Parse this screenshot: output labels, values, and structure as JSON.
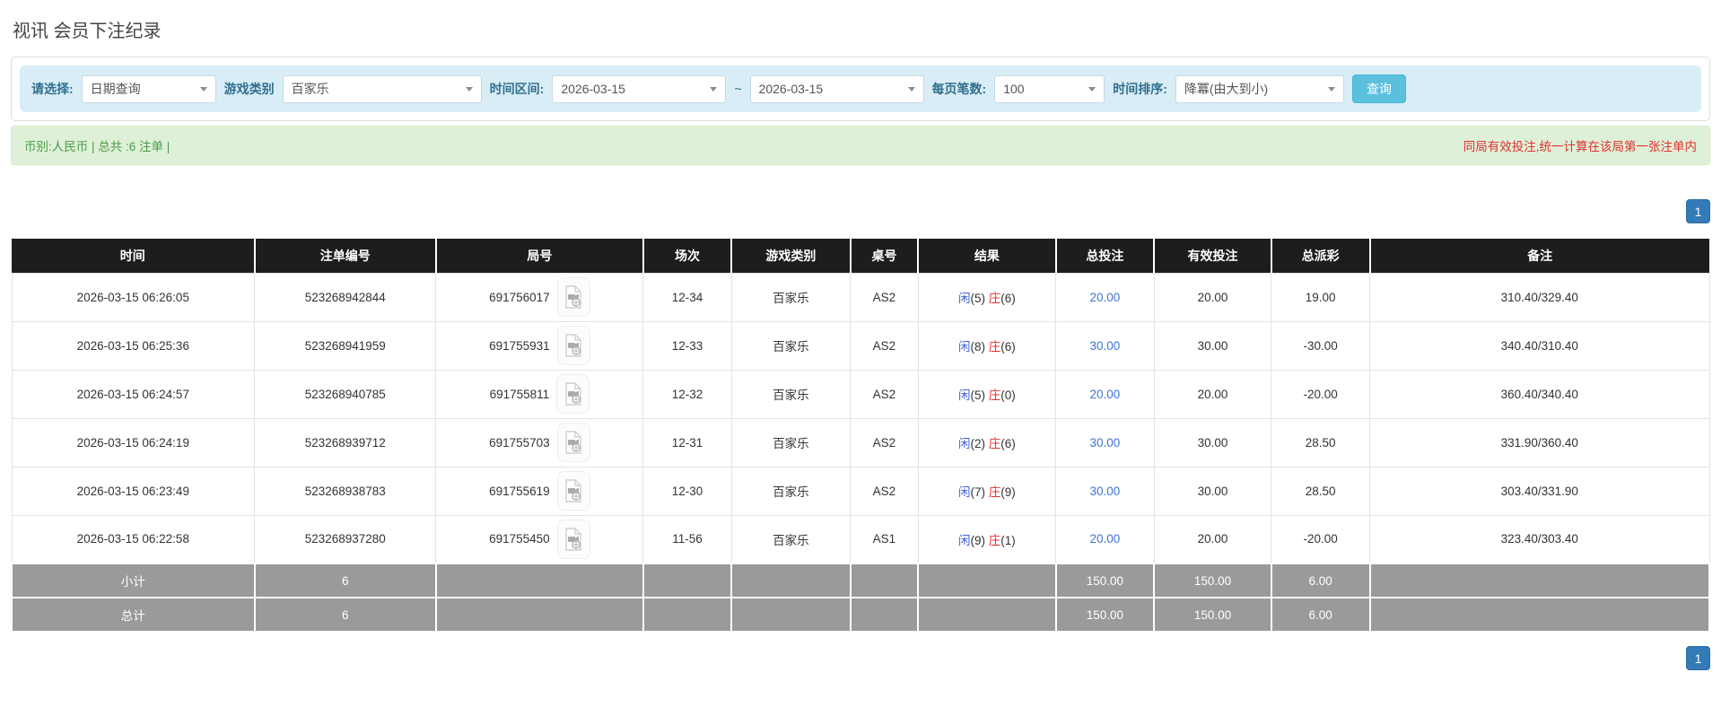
{
  "page": {
    "title": "视讯 会员下注纪录"
  },
  "filter": {
    "query_type_label": "请选择:",
    "query_type_value": "日期查询",
    "game_type_label": "游戏类别",
    "game_type_value": "百家乐",
    "date_range_label": "时间区间:",
    "date_from": "2026-03-15",
    "date_separator": "~",
    "date_to": "2026-03-15",
    "page_size_label": "每页笔数:",
    "page_size_value": "100",
    "time_sort_label": "时间排序:",
    "time_sort_value": "降冪(由大到小)",
    "search_button_label": "查询"
  },
  "summary": {
    "currency_text": "币别:人民币 | 总共 :6 注单 |",
    "note_text": "同局有效投注,统一计算在该局第一张注单内"
  },
  "pagination": {
    "current_page": "1"
  },
  "table": {
    "headers": [
      "时间",
      "注单编号",
      "局号",
      "场次",
      "游戏类别",
      "桌号",
      "结果",
      "总投注",
      "有效投注",
      "总派彩",
      "备注"
    ],
    "rows": [
      {
        "time": "2026-03-15 06:26:05",
        "bet_id": "523268942844",
        "round_id": "691756017",
        "session": "12-34",
        "game": "百家乐",
        "table_no": "AS2",
        "result": {
          "player_label": "闲",
          "player_score": "(5)",
          "banker_label": "庄",
          "banker_score": "(6)"
        },
        "total_bet": "20.00",
        "valid_bet": "20.00",
        "payout": "19.00",
        "payout_negative": false,
        "remark": "310.40/329.40"
      },
      {
        "time": "2026-03-15 06:25:36",
        "bet_id": "523268941959",
        "round_id": "691755931",
        "session": "12-33",
        "game": "百家乐",
        "table_no": "AS2",
        "result": {
          "player_label": "闲",
          "player_score": "(8)",
          "banker_label": "庄",
          "banker_score": "(6)"
        },
        "total_bet": "30.00",
        "valid_bet": "30.00",
        "payout": "-30.00",
        "payout_negative": true,
        "remark": "340.40/310.40"
      },
      {
        "time": "2026-03-15 06:24:57",
        "bet_id": "523268940785",
        "round_id": "691755811",
        "session": "12-32",
        "game": "百家乐",
        "table_no": "AS2",
        "result": {
          "player_label": "闲",
          "player_score": "(5)",
          "banker_label": "庄",
          "banker_score": "(0)"
        },
        "total_bet": "20.00",
        "valid_bet": "20.00",
        "payout": "-20.00",
        "payout_negative": true,
        "remark": "360.40/340.40"
      },
      {
        "time": "2026-03-15 06:24:19",
        "bet_id": "523268939712",
        "round_id": "691755703",
        "session": "12-31",
        "game": "百家乐",
        "table_no": "AS2",
        "result": {
          "player_label": "闲",
          "player_score": "(2)",
          "banker_label": "庄",
          "banker_score": "(6)"
        },
        "total_bet": "30.00",
        "valid_bet": "30.00",
        "payout": "28.50",
        "payout_negative": false,
        "remark": "331.90/360.40"
      },
      {
        "time": "2026-03-15 06:23:49",
        "bet_id": "523268938783",
        "round_id": "691755619",
        "session": "12-30",
        "game": "百家乐",
        "table_no": "AS2",
        "result": {
          "player_label": "闲",
          "player_score": "(7)",
          "banker_label": "庄",
          "banker_score": "(9)"
        },
        "total_bet": "30.00",
        "valid_bet": "30.00",
        "payout": "28.50",
        "payout_negative": false,
        "remark": "303.40/331.90"
      },
      {
        "time": "2026-03-15 06:22:58",
        "bet_id": "523268937280",
        "round_id": "691755450",
        "session": "11-56",
        "game": "百家乐",
        "table_no": "AS1",
        "result": {
          "player_label": "闲",
          "player_score": "(9)",
          "banker_label": "庄",
          "banker_score": "(1)"
        },
        "total_bet": "20.00",
        "valid_bet": "20.00",
        "payout": "-20.00",
        "payout_negative": true,
        "remark": "323.40/303.40"
      }
    ],
    "footer_rows": [
      {
        "label": "小计",
        "bet_count": "6",
        "total_bet": "150.00",
        "valid_bet": "150.00",
        "payout": "6.00"
      },
      {
        "label": "总计",
        "bet_count": "6",
        "total_bet": "150.00",
        "valid_bet": "150.00",
        "payout": "6.00"
      }
    ]
  },
  "icons": {
    "round_replay": "video-file-icon",
    "select_caret": "chevron-down-icon"
  },
  "colors": {
    "header_bg": "#1d1d1d",
    "footer_bg": "#9a9a9a",
    "filter_bar_bg": "#d9edf7",
    "summary_bg": "#dff0d8",
    "summary_green": "#4a9b4a",
    "note_red": "#e03131",
    "player_blue": "#4166d5",
    "banker_red": "#e03131",
    "bet_link_blue": "#3d74d6",
    "negative_red": "#e03131",
    "search_button_bg": "#5bc0de",
    "pager_bg": "#337ab7"
  }
}
